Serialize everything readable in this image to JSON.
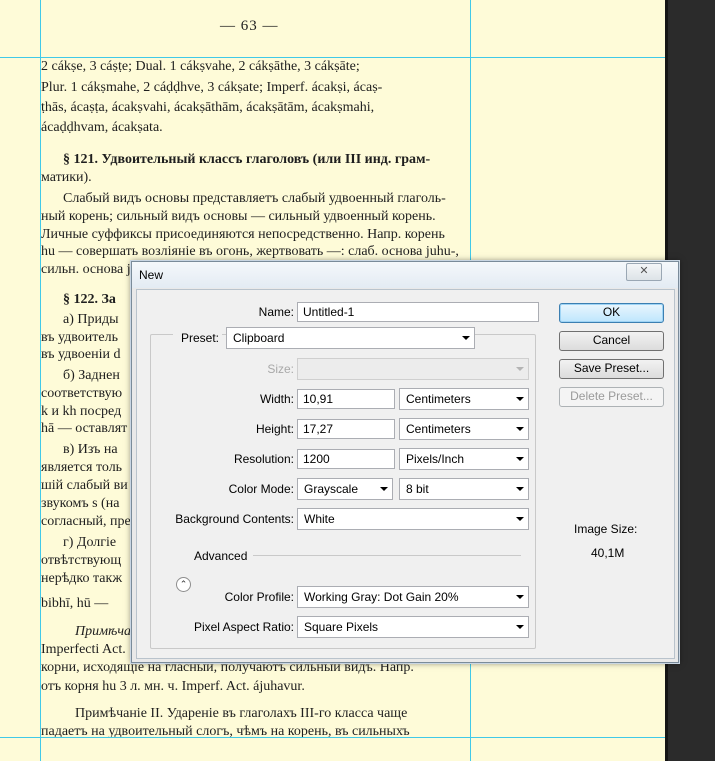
{
  "document": {
    "page_number": "— 63 —",
    "lines": [
      "2 cákṣe, 3 cáṣṭe; Dual. 1 cákṣvahe, 2 cákṣāthe, 3 cákṣāte;",
      "Plur. 1 cákṣmahe, 2 cáḍḍhve, 3 cákṣate; Imperf. ácakṣi, ácaṣ-",
      "ṭhās, ácaṣṭa, ácakṣvahi, ácakṣāthām, ácakṣātām, ácakṣmahi,",
      "ácaḍḍhvam, ácakṣata.",
      "§ 121. Удвоительный классъ глаголовъ (или III инд. грам-",
      "матики).",
      "Слабый видъ основы представляетъ слабый удвоенный глаголь-",
      "ный корень; сильный видъ основы — сильный удвоенный корень.",
      "Личные суффиксы присоединяются непосредственно. Напр. корень",
      "hu — совершать возліяніе въ огонь, жертвовать —: слаб. основа juhu-,",
      "сильн. основа ju",
      "§ 122. За",
      "а) Приды",
      "въ удвоитель",
      "въ удвоеніи d",
      "б) Заднен",
      "соответствую",
      "k и kh посред",
      "hā — оставлят",
      "в) Изъ на",
      "является толь",
      "шій слабый ви",
      "звукомъ s (на",
      "согласный, пре",
      "г) Долгіе",
      "отвѣтствующ",
      "нерѣдко такж",
      "bibhī, hū —",
      "Примѣча",
      "Imperfecti Act.",
      "корни, исходящіе на гласный, получаютъ сильный видъ. Напр.",
      "отъ корня hu 3 л. мн. ч. Imperf. Act. ájuhavur.",
      "Примѣчаніе II. Удареніе въ глаголахъ III-го класса чаще",
      "падаетъ на удвоительный слогъ, чѣмъ на корень, въ сильныхъ"
    ]
  },
  "dialog": {
    "title": "New",
    "close_glyph": "✕",
    "fields": {
      "name": {
        "label": "Name:",
        "value": "Untitled-1"
      },
      "preset": {
        "label": "Preset:",
        "value": "Clipboard"
      },
      "size": {
        "label": "Size:",
        "value": ""
      },
      "width": {
        "label": "Width:",
        "value": "10,91",
        "unit": "Centimeters"
      },
      "height": {
        "label": "Height:",
        "value": "17,27",
        "unit": "Centimeters"
      },
      "resolution": {
        "label": "Resolution:",
        "value": "1200",
        "unit": "Pixels/Inch"
      },
      "color_mode": {
        "label": "Color Mode:",
        "value": "Grayscale",
        "depth": "8 bit"
      },
      "background": {
        "label": "Background Contents:",
        "value": "White"
      },
      "advanced": {
        "label": "Advanced",
        "icon": "expand-collapse-icon",
        "glyph": "⌃"
      },
      "color_profile": {
        "label": "Color Profile:",
        "value": "Working Gray:  Dot Gain 20%"
      },
      "pixel_aspect": {
        "label": "Pixel Aspect Ratio:",
        "value": "Square Pixels"
      }
    },
    "buttons": {
      "ok": "OK",
      "cancel": "Cancel",
      "save_preset": "Save Preset...",
      "delete_preset": "Delete Preset..."
    },
    "image_size": {
      "label": "Image Size:",
      "value": "40,1M"
    }
  },
  "colors": {
    "canvas": "#fefbd8",
    "guide": "#41c9e8",
    "workspace": "#2b2b2b",
    "dialog_bg": "#f0f0f0",
    "default_button": "#3c7fb1"
  }
}
